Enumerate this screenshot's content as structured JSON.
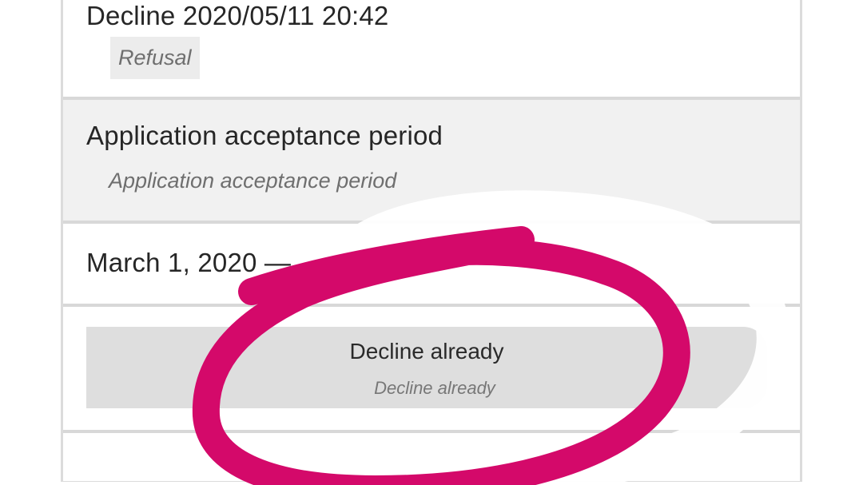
{
  "status": {
    "title": "Decline 2020/05/11 20:42",
    "tag": "Refusal"
  },
  "period": {
    "title": "Application acceptance period",
    "subtitle": "Application acceptance period"
  },
  "date": {
    "title": "March 1, 2020 —"
  },
  "action": {
    "label": "Decline already",
    "sublabel": "Decline already"
  },
  "annotation": {
    "highlight_color": "#d4096a",
    "glow_color": "#ffffff"
  }
}
